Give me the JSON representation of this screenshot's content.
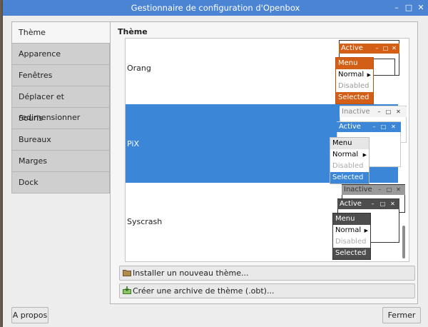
{
  "window": {
    "title": "Gestionnaire de configuration d'Openbox"
  },
  "sidebar": {
    "items": [
      {
        "label": "Thème"
      },
      {
        "label": "Apparence"
      },
      {
        "label": "Fenêtres"
      },
      {
        "label": "Déplacer et redimensionner"
      },
      {
        "label": "Souris"
      },
      {
        "label": "Bureaux"
      },
      {
        "label": "Marges"
      },
      {
        "label": "Dock"
      }
    ]
  },
  "main": {
    "section_title": "Thème",
    "themes": [
      {
        "name": "Orang",
        "selected": false
      },
      {
        "name": "PiX",
        "selected": true
      },
      {
        "name": "Syscrash",
        "selected": false
      }
    ],
    "preview": {
      "inactive": "Inactive",
      "active": "Active",
      "menu": "Menu",
      "normal": "Normal",
      "disabled": "Disabled",
      "selected": "Selected"
    },
    "install_button": "Installer un nouveau thème...",
    "archive_button": "Créer une archive de thème (.obt)..."
  },
  "footer": {
    "about_button": "A propos",
    "close_button": "Fermer"
  },
  "colors": {
    "accent": "#3c86d8",
    "titlebar": "#4a84d3",
    "orang": "#d35f17",
    "syscrash": "#4d4d4d"
  }
}
